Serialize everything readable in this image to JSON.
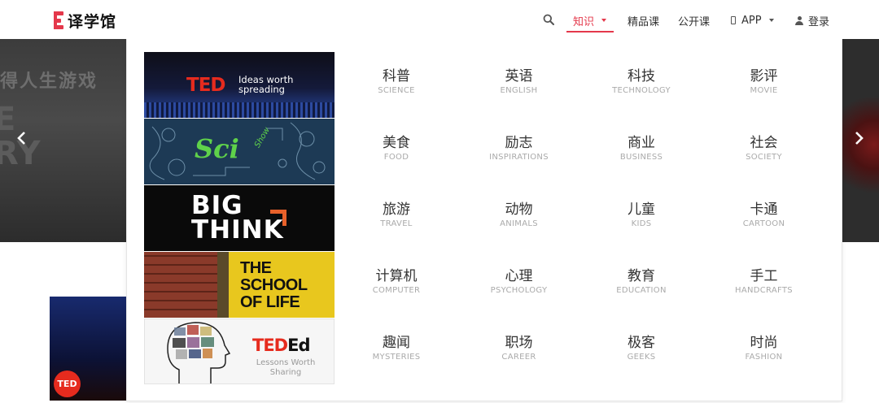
{
  "header": {
    "logo_text": "译学馆",
    "nav": [
      {
        "label": "知识",
        "active": true,
        "has_caret": true
      },
      {
        "label": "精品课"
      },
      {
        "label": "公开课"
      },
      {
        "label": "APP",
        "has_caret": true,
        "icon": "phone-icon"
      },
      {
        "label": "登录",
        "icon": "user-icon"
      }
    ],
    "accent_color": "#e4384b"
  },
  "banner": {
    "text_line1": "得人生游戏",
    "text_line2a": "E",
    "text_line2b": "RY"
  },
  "thumbnail": {
    "badge": "TED"
  },
  "dropdown": {
    "channels": [
      {
        "name": "TED",
        "tagline1": "Ideas worth",
        "tagline2": "spreading"
      },
      {
        "name": "Sci",
        "suffix": "Show"
      },
      {
        "line1": "BIG",
        "line2": "THINK"
      },
      {
        "line1": "THE",
        "line2": "SCHOOL",
        "line3": "OF LIFE"
      },
      {
        "name_a": "TED",
        "name_b": "Ed",
        "tagline1": "Lessons Worth",
        "tagline2": "Sharing"
      }
    ],
    "categories": [
      {
        "zh": "科普",
        "en": "SCIENCE"
      },
      {
        "zh": "英语",
        "en": "ENGLISH"
      },
      {
        "zh": "科技",
        "en": "TECHNOLOGY"
      },
      {
        "zh": "影评",
        "en": "MOVIE"
      },
      {
        "zh": "美食",
        "en": "FOOD"
      },
      {
        "zh": "励志",
        "en": "INSPIRATIONS"
      },
      {
        "zh": "商业",
        "en": "BUSINESS"
      },
      {
        "zh": "社会",
        "en": "SOCIETY"
      },
      {
        "zh": "旅游",
        "en": "TRAVEL"
      },
      {
        "zh": "动物",
        "en": "ANIMALS"
      },
      {
        "zh": "儿童",
        "en": "KIDS"
      },
      {
        "zh": "卡通",
        "en": "CARTOON"
      },
      {
        "zh": "计算机",
        "en": "COMPUTER"
      },
      {
        "zh": "心理",
        "en": "PSYCHOLOGY"
      },
      {
        "zh": "教育",
        "en": "EDUCATION"
      },
      {
        "zh": "手工",
        "en": "HANDCRAFTS"
      },
      {
        "zh": "趣闻",
        "en": "MYSTERIES"
      },
      {
        "zh": "职场",
        "en": "CAREER"
      },
      {
        "zh": "极客",
        "en": "GEEKS"
      },
      {
        "zh": "时尚",
        "en": "FASHION"
      }
    ]
  }
}
